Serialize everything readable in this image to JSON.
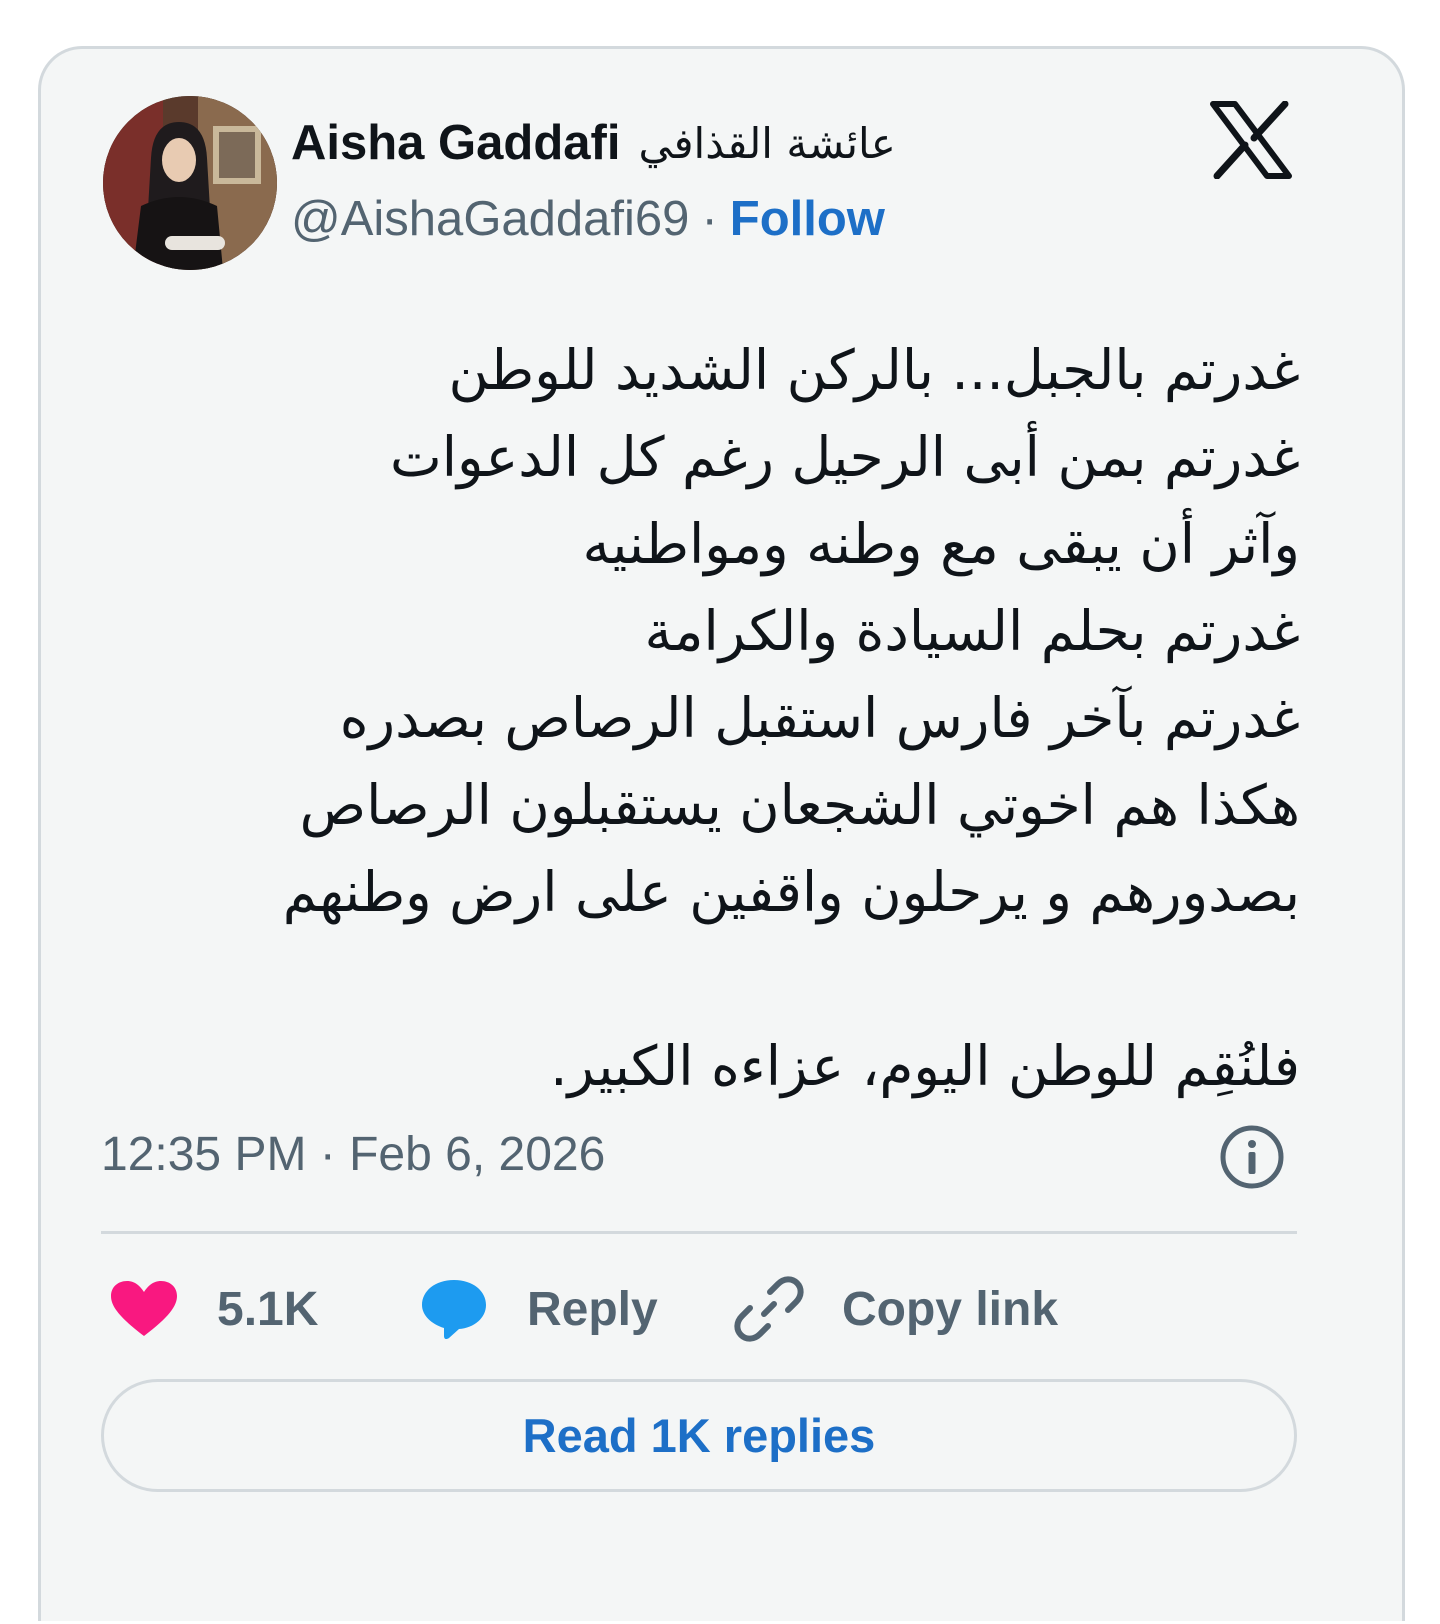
{
  "author": {
    "name": "Aisha Gaddafi",
    "arabic_name": "عائشة القذافي",
    "handle": "@AishaGaddafi69",
    "separator": "·",
    "follow_label": "Follow"
  },
  "brand_icon": "x-logo-icon",
  "tweet": {
    "lines": [
      "غدرتم بالجبل... بالركن الشديد للوطن",
      "غدرتم بمن أبى الرحيل رغم كل الدعوات",
      "وآثر أن يبقى مع وطنه ومواطنيه",
      "غدرتم بحلم السيادة والكرامة",
      "غدرتم بآخر فارس استقبل الرصاص بصدره",
      "هكذا هم اخوتي الشجعان يستقبلون الرصاص",
      "بصدورهم و يرحلون واقفين على ارض وطنهم",
      "",
      "فلنُقِم للوطن اليوم، عزاءه الكبير."
    ]
  },
  "timestamp": "12:35 PM · Feb 6, 2026",
  "actions": {
    "like_count": "5.1K",
    "reply_label": "Reply",
    "copy_label": "Copy link"
  },
  "read_replies_label": "Read 1K replies",
  "colors": {
    "accent": "#1d6fc7",
    "like": "#f91880",
    "reply_bubble": "#1d9bf0",
    "text": "#0f1419",
    "secondary": "#536471"
  }
}
